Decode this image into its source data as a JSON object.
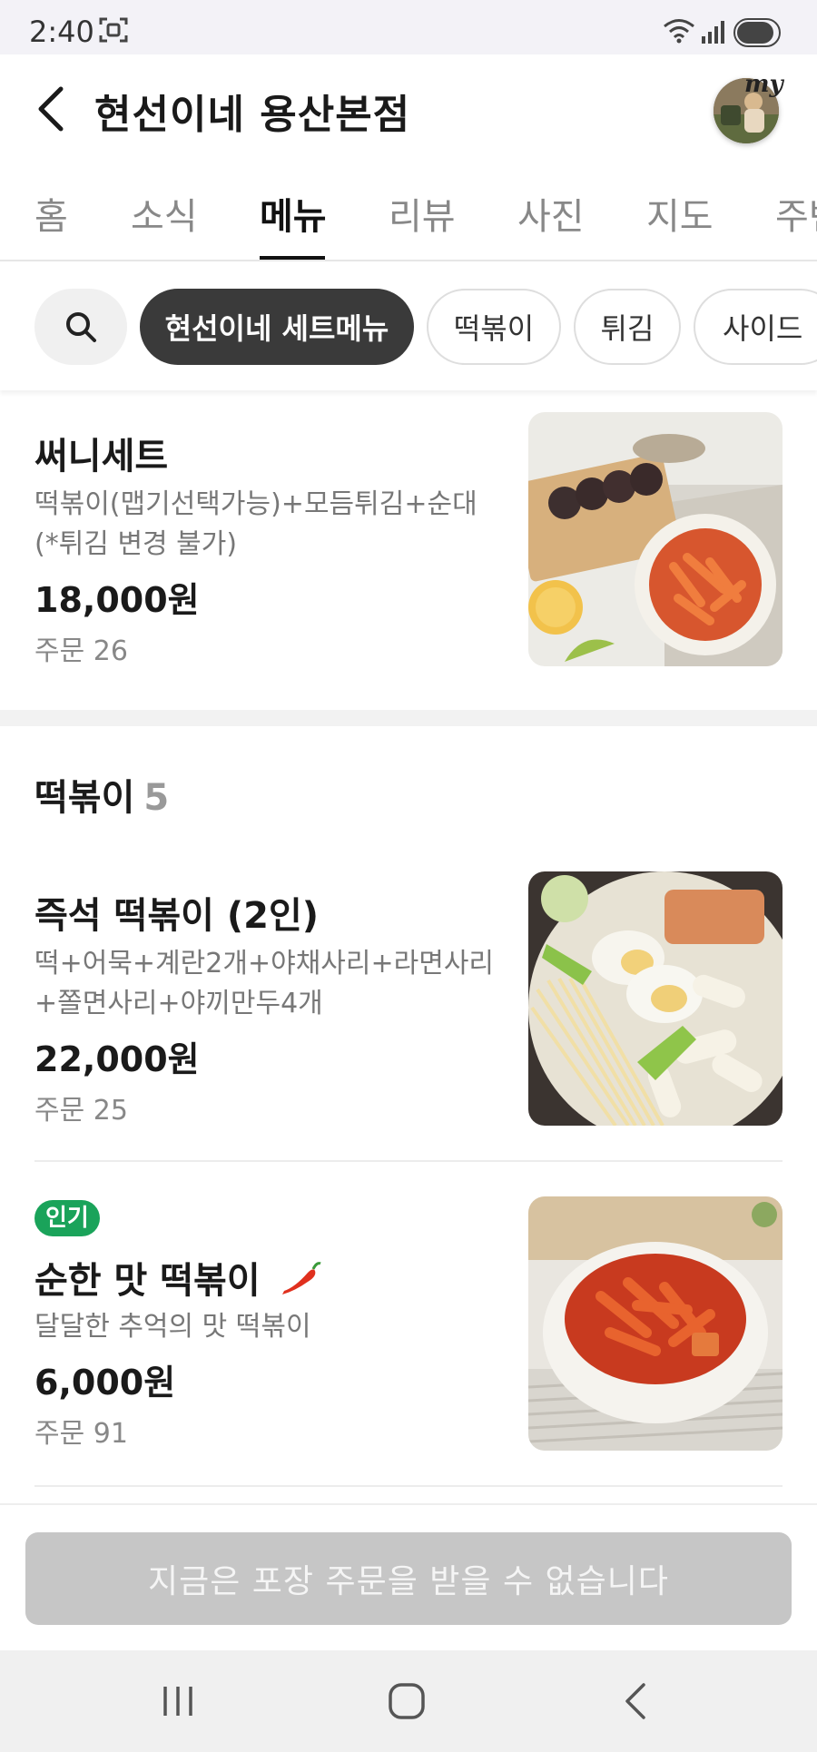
{
  "status_bar": {
    "time": "2:40"
  },
  "header": {
    "title": "현선이네 용산본점",
    "avatar_badge": "my"
  },
  "tabs": [
    {
      "label": "홈",
      "active": false
    },
    {
      "label": "소식",
      "active": false
    },
    {
      "label": "메뉴",
      "active": true
    },
    {
      "label": "리뷰",
      "active": false
    },
    {
      "label": "사진",
      "active": false
    },
    {
      "label": "지도",
      "active": false
    },
    {
      "label": "주변",
      "active": false
    }
  ],
  "filters": [
    {
      "label": "현선이네 세트메뉴",
      "active": true
    },
    {
      "label": "떡볶이",
      "active": false
    },
    {
      "label": "튀김",
      "active": false
    },
    {
      "label": "사이드",
      "active": false
    }
  ],
  "set_item": {
    "name": "써니세트",
    "desc": "떡볶이(맵기선택가능)+모듬튀김+순대(*튀김 변경 불가)",
    "price": "18,000원",
    "orders": "주문 26"
  },
  "section": {
    "title": "떡볶이",
    "count": "5"
  },
  "items": [
    {
      "name": "즉석 떡볶이 (2인)",
      "desc": "떡+어묵+계란2개+야채사리+라면사리+쫄면사리+야끼만두4개",
      "price": "22,000원",
      "orders": "주문 25"
    },
    {
      "badge": "인기",
      "name": "순한 맛 떡볶이",
      "desc": "달달한 추억의 맛 떡볶이",
      "price": "6,000원",
      "orders": "주문 91",
      "icon": "chili-pepper-icon"
    }
  ],
  "bottom": {
    "order_button": "지금은 포장 주문을 받을 수 없습니다"
  },
  "colors": {
    "popular_badge": "#1aa35a",
    "active_chip": "#3a3a3a",
    "disabled_button": "#c6c6c6"
  }
}
